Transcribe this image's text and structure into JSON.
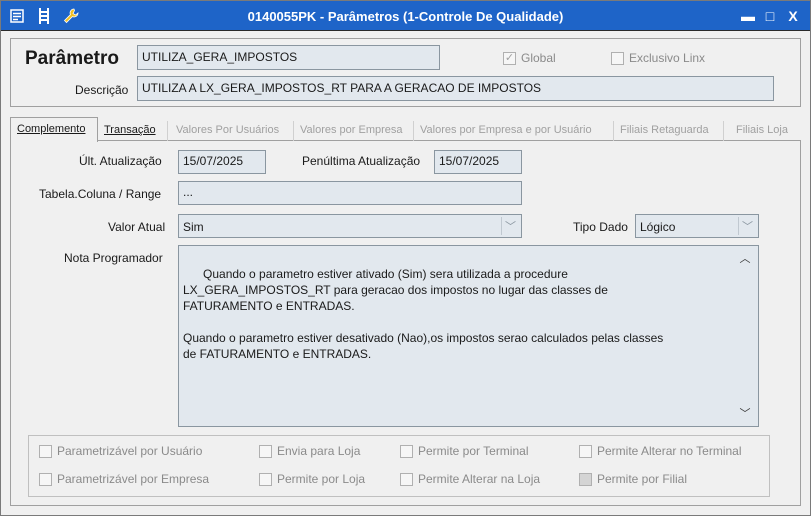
{
  "window": {
    "title": "0140055PK - Parâmetros (1-Controle De Qualidade)",
    "accent": "#1e64c8",
    "left_icons": [
      "list-icon",
      "ladder-icon",
      "wrench-icon"
    ],
    "controls": {
      "minimize": "▬",
      "maximize": "□",
      "close": "X"
    }
  },
  "header": {
    "parametro_label": "Parâmetro",
    "parametro_value": "UTILIZA_GERA_IMPOSTOS",
    "global_label": "Global",
    "global_checked": true,
    "exclusivo_label": "Exclusivo Linx",
    "descricao_label": "Descrição",
    "descricao_value": "UTILIZA A LX_GERA_IMPOSTOS_RT PARA A GERACAO DE IMPOSTOS"
  },
  "tabs": [
    {
      "label": "Complemento",
      "state": "active"
    },
    {
      "label": "Transação",
      "state": "enabled"
    },
    {
      "label": "Valores Por Usuários",
      "state": "disabled"
    },
    {
      "label": "Valores por Empresa",
      "state": "disabled"
    },
    {
      "label": "Valores por Empresa e por Usuário",
      "state": "disabled"
    },
    {
      "label": "Filiais Retaguarda",
      "state": "disabled"
    },
    {
      "label": "Filiais Loja",
      "state": "disabled"
    }
  ],
  "complemento": {
    "ult_atualizacao_label": "Últ. Atualização",
    "ult_atualizacao_value": "15/07/2025",
    "penultima_label": "Penúltima Atualização",
    "penultima_value": "15/07/2025",
    "tabela_label": "Tabela.Coluna / Range",
    "tabela_value": "...",
    "valor_atual_label": "Valor Atual",
    "valor_atual_value": "Sim",
    "tipo_dado_label": "Tipo Dado",
    "tipo_dado_value": "Lógico",
    "nota_label": "Nota Programador",
    "nota_value": "Quando o parametro estiver ativado (Sim) sera utilizada a procedure\nLX_GERA_IMPOSTOS_RT para geracao dos impostos no lugar das classes de\nFATURAMENTO e ENTRADAS.\n\nQuando o parametro estiver desativado (Nao),os impostos serao calculados pelas classes\nde FATURAMENTO e ENTRADAS."
  },
  "options": [
    {
      "label": "Parametrizável por Usuário",
      "checked": false
    },
    {
      "label": "Envia para Loja",
      "checked": false
    },
    {
      "label": "Permite por Terminal",
      "checked": false
    },
    {
      "label": "Permite Alterar no Terminal",
      "checked": false
    },
    {
      "label": "Parametrizável por Empresa",
      "checked": false
    },
    {
      "label": "Permite por Loja",
      "checked": false
    },
    {
      "label": "Permite Alterar na Loja",
      "checked": false
    },
    {
      "label": "Permite por Filial",
      "checked": "indeterminate"
    }
  ]
}
